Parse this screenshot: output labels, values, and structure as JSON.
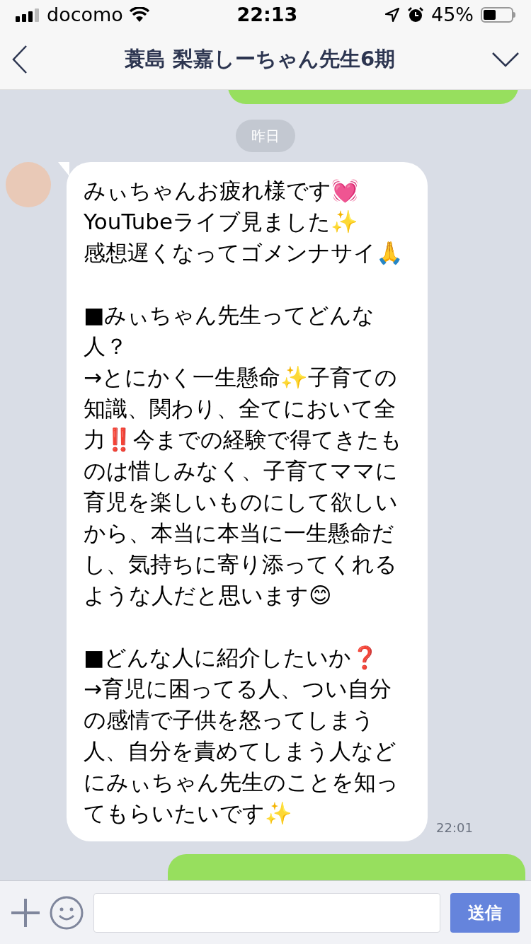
{
  "status_bar": {
    "carrier": "docomo",
    "time": "22:13",
    "battery": "45%"
  },
  "header": {
    "title": "蓑島 梨嘉しーちゃん先生6期"
  },
  "date_divider": "昨日",
  "message": {
    "text": "みぃちゃんお疲れ様です💓\nYouTubeライブ見ました✨\n感想遅くなってゴメンナサイ🙏\n\n■みぃちゃん先生ってどんな人？\n→とにかく一生懸命✨子育ての知識、関わり、全てにおいて全力‼️今までの経験で得てきたものは惜しみなく、子育てママに育児を楽しいものにして欲しいから、本当に本当に一生懸命だし、気持ちに寄り添ってくれるような人だと思います😊\n\n■どんな人に紹介したいか❓\n→育児に困ってる人、つい自分の感情で子供を怒ってしまう人、自分を責めてしまう人などにみぃちゃん先生のことを知ってもらいたいです✨",
    "time": "22:01"
  },
  "composer": {
    "send": "送信"
  }
}
